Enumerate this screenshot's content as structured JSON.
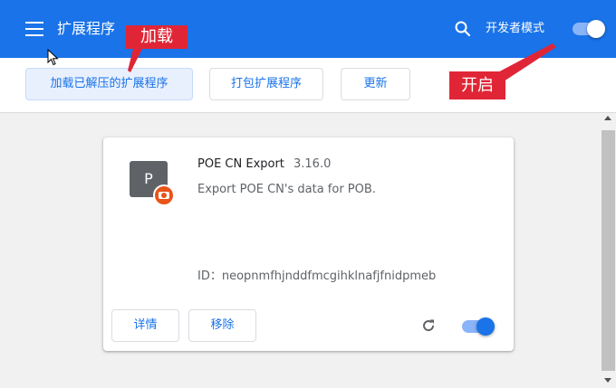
{
  "header": {
    "title": "扩展程序",
    "dev_mode_label": "开发者模式",
    "dev_mode_enabled": true,
    "icons": {
      "menu": "menu-icon",
      "search": "search-icon"
    }
  },
  "toolbar": {
    "load_unpacked": "加载已解压的扩展程序",
    "pack": "打包扩展程序",
    "update": "更新"
  },
  "extension": {
    "icon_letter": "P",
    "name": "POE CN Export",
    "version": "3.16.0",
    "description": "Export POE CN's data for POB.",
    "id_text": "ID：neopnmfhjnddfmcgihklnafjfnidpmeb",
    "details_label": "详情",
    "remove_label": "移除",
    "enabled": true,
    "icons": {
      "reload": "reload-icon",
      "badge": "camera-badge-icon"
    }
  },
  "annotations": {
    "load": "加载",
    "enable": "开启"
  },
  "colors": {
    "brand": "#1a73e8",
    "annotation": "#e02636",
    "badge": "#e8541a"
  }
}
